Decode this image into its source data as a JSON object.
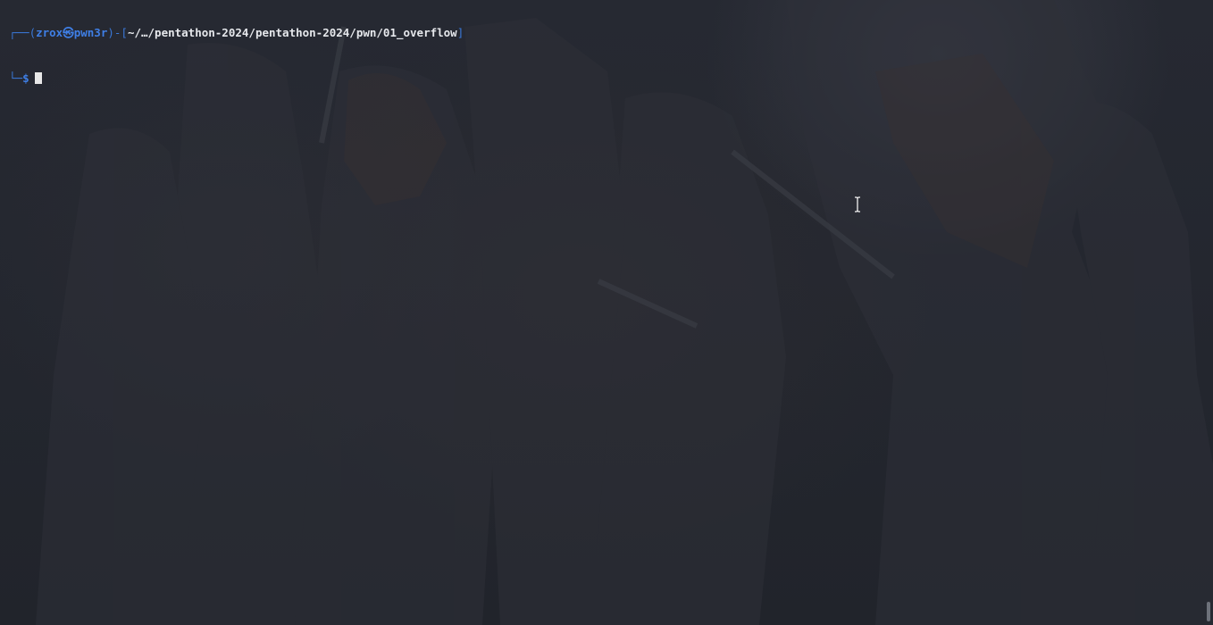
{
  "terminal": {
    "prompt": {
      "frame_open": "┌──(",
      "user": "zrox",
      "at_symbol": "㉿",
      "host": "pwn3r",
      "frame_mid": ")-[",
      "cwd": "~/…/pentathon-2024/pentathon-2024/pwn/01_overflow",
      "frame_close": "]",
      "line2_frame": "└─",
      "symbol": "$"
    }
  },
  "colors": {
    "background": "#23262f",
    "prompt_blue": "#3f7fe6",
    "path_text": "#e6e8ec",
    "cursor": "#e8e8e8"
  },
  "icons": {
    "mouse_pointer": "i-beam-cursor"
  }
}
